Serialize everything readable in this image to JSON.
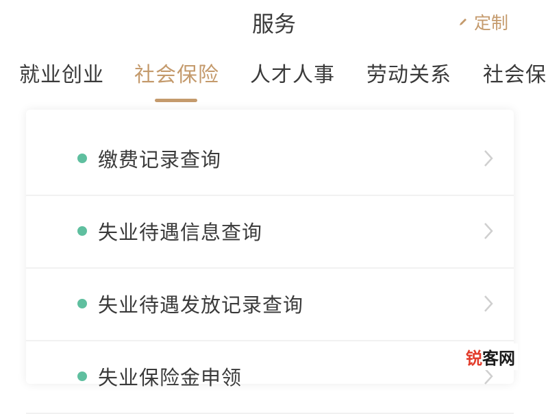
{
  "header": {
    "title": "服务",
    "customize_label": "定制",
    "customize_icon": "pen-icon"
  },
  "tabs": [
    {
      "label": "就业创业",
      "active": false
    },
    {
      "label": "社会保险",
      "active": true
    },
    {
      "label": "人才人事",
      "active": false
    },
    {
      "label": "劳动关系",
      "active": false
    },
    {
      "label": "社会保",
      "active": false
    }
  ],
  "list": {
    "items": [
      {
        "label": "缴费记录查询"
      },
      {
        "label": "失业待遇信息查询"
      },
      {
        "label": "失业待遇发放记录查询"
      },
      {
        "label": "失业保险金申领"
      }
    ],
    "chevron_icon": "chevron-right-icon"
  },
  "watermark": {
    "first": "锐",
    "rest": "客网"
  },
  "colors": {
    "accent": "#c49a6c",
    "dot": "#5fbf9f",
    "text": "#3a3a3a",
    "watermark_red": "#e23b2a"
  }
}
